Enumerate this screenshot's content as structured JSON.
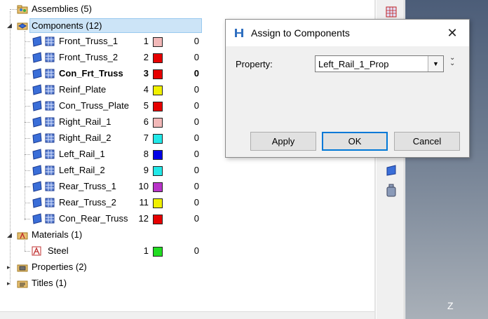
{
  "tree": {
    "assemblies": {
      "label": "Assemblies (5)"
    },
    "components": {
      "label": "Components (12)",
      "items": [
        {
          "name": "Front_Truss_1",
          "id": "1",
          "color": "#f2b8b8",
          "count": "0",
          "bold": false
        },
        {
          "name": "Front_Truss_2",
          "id": "2",
          "color": "#e60000",
          "count": "0",
          "bold": false
        },
        {
          "name": "Con_Frt_Truss",
          "id": "3",
          "color": "#e60000",
          "count": "0",
          "bold": true
        },
        {
          "name": "Reinf_Plate",
          "id": "4",
          "color": "#f0f000",
          "count": "0",
          "bold": false
        },
        {
          "name": "Con_Truss_Plate",
          "id": "5",
          "color": "#e60000",
          "count": "0",
          "bold": false
        },
        {
          "name": "Right_Rail_1",
          "id": "6",
          "color": "#f2b8b8",
          "count": "0",
          "bold": false
        },
        {
          "name": "Right_Rail_2",
          "id": "7",
          "color": "#22e8e8",
          "count": "0",
          "bold": false
        },
        {
          "name": "Left_Rail_1",
          "id": "8",
          "color": "#0000e6",
          "count": "0",
          "bold": false
        },
        {
          "name": "Left_Rail_2",
          "id": "9",
          "color": "#22e8e8",
          "count": "0",
          "bold": false
        },
        {
          "name": "Rear_Truss_1",
          "id": "10",
          "color": "#b833c8",
          "count": "0",
          "bold": false
        },
        {
          "name": "Rear_Truss_2",
          "id": "11",
          "color": "#f0f000",
          "count": "0",
          "bold": false
        },
        {
          "name": "Con_Rear_Truss",
          "id": "12",
          "color": "#e60000",
          "count": "0",
          "bold": false
        }
      ]
    },
    "materials": {
      "label": "Materials (1)",
      "items": [
        {
          "name": "Steel",
          "id": "1",
          "color": "#22dd22",
          "count": "0"
        }
      ]
    },
    "properties": {
      "label": "Properties (2)"
    },
    "titles": {
      "label": "Titles (1)"
    }
  },
  "dialog": {
    "title": "Assign to Components",
    "property_label": "Property:",
    "property_value": "Left_Rail_1_Prop",
    "apply_label": "Apply",
    "ok_label": "OK",
    "cancel_label": "Cancel"
  },
  "viewport": {
    "axis_label": "Z"
  }
}
